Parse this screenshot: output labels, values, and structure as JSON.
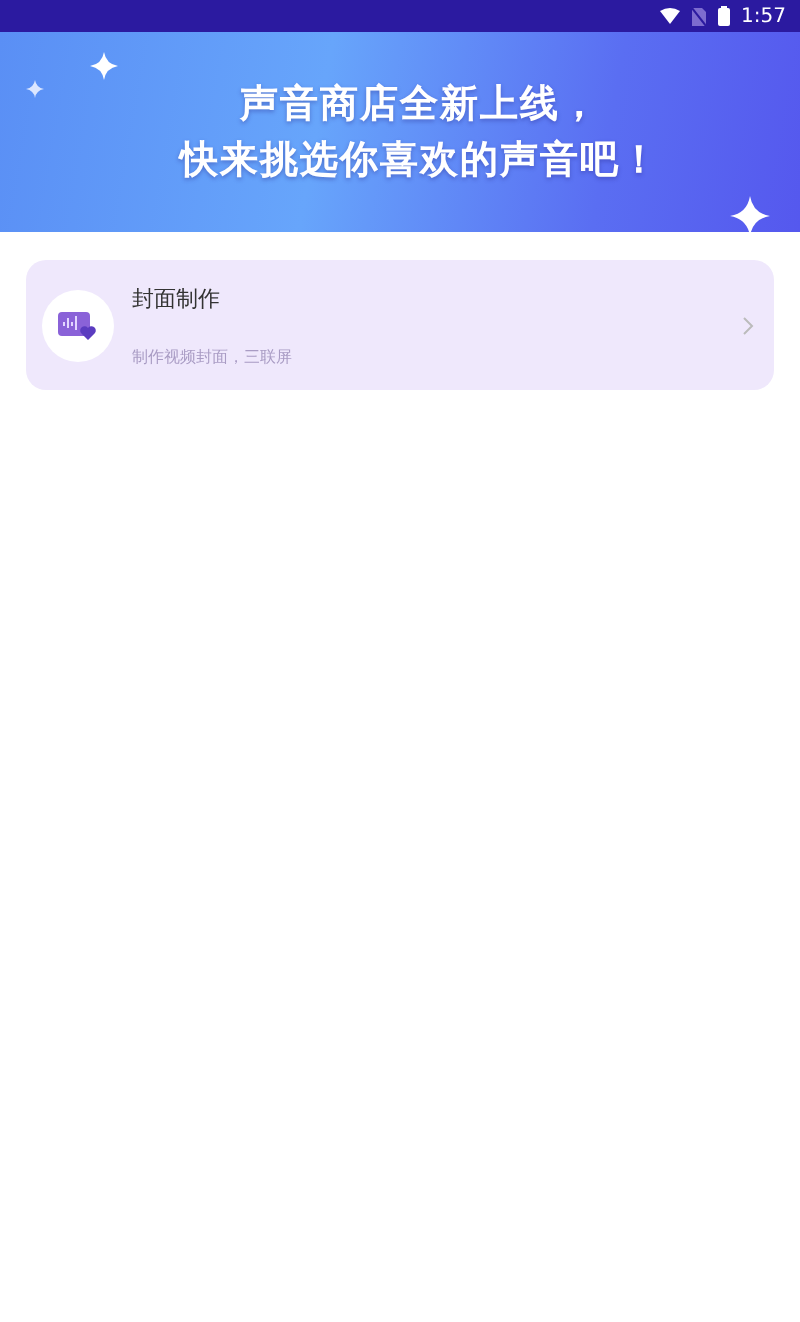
{
  "status_bar": {
    "time": "1:57"
  },
  "banner": {
    "lines": [
      "声音商店全新上线，",
      "快来挑选你喜欢的声音吧！"
    ]
  },
  "items": [
    {
      "title": "封面制作",
      "subtitle": "制作视频封面，三联屏"
    }
  ]
}
